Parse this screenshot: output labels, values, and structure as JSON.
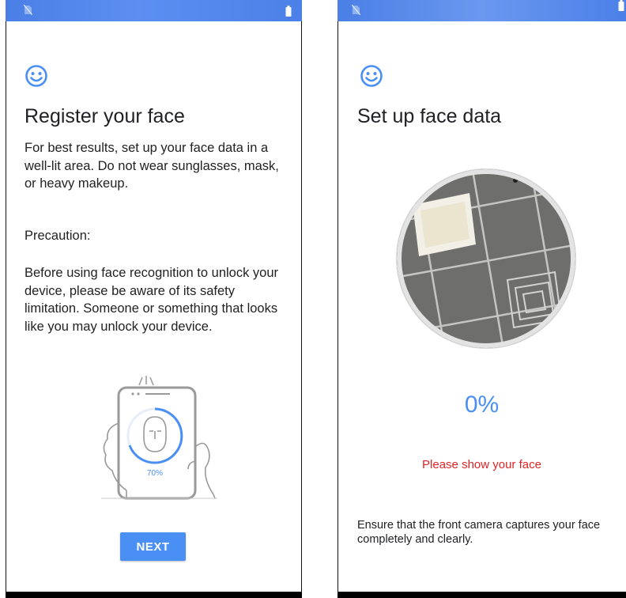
{
  "left_screen": {
    "title": "Register your face",
    "intro": "For best results, set up your face data in a well-lit area. Do not wear sunglasses, mask, or heavy makeup.",
    "precaution_label": "Precaution:",
    "precaution_text": "Before using face recognition to unlock your device, please be aware of its safety limitation. Someone or something that looks like you may unlock your device.",
    "illustration_progress_label": "70%",
    "next_label": "NEXT"
  },
  "right_screen": {
    "title": "Set up face data",
    "progress_label": "0%",
    "status_message": "Please show your face",
    "hint": "Ensure that the front camera captures your face completely and clearly."
  },
  "icons": {
    "status_left": "no-sim-icon",
    "status_right": "battery-icon",
    "header": "smile-icon"
  },
  "colors": {
    "accent": "#4a8ff3",
    "status_bar": "#4f85ea",
    "error": "#e02424"
  }
}
